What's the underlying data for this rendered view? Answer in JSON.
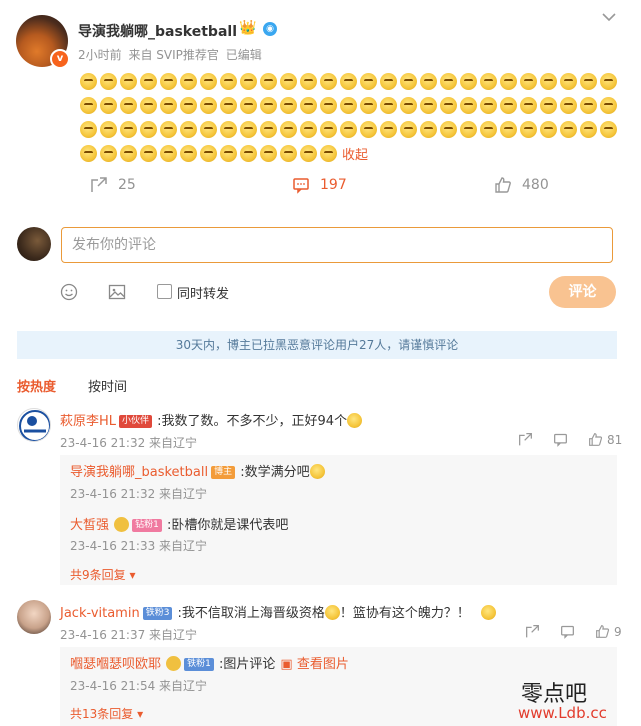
{
  "post": {
    "author": "导演我躺哪_basketball",
    "meta": {
      "time": "2小时前",
      "source": "来自 SVIP推荐官",
      "edited": "已编辑"
    },
    "emoji_count": 94,
    "collapse_label": "收起",
    "forwards": "25",
    "comments": "197",
    "likes": "480"
  },
  "composer": {
    "placeholder": "发布你的评论",
    "forward_label": "同时转发",
    "submit_label": "评论"
  },
  "notice": "30天内，博主已拉黑恶意评论用户27人，请谨慎评论",
  "sort": {
    "hot": "按热度",
    "time": "按时间"
  },
  "comments": [
    {
      "name": "萩原李HL",
      "tag": "小伙伴",
      "text": ":我数了数。不多不少，正好94个",
      "time": "23-4-16 21:32 来自辽宁",
      "likes": "81",
      "replies": [
        {
          "name": "导演我躺哪_basketball",
          "tag": "博主",
          "text": ":数学满分吧",
          "time": "23-4-16 21:32 来自辽宁"
        },
        {
          "name": "大皙强",
          "tag": "钻粉1",
          "text": ":卧槽你就是课代表吧",
          "time": "23-4-16 21:33 来自辽宁"
        }
      ],
      "more": "共9条回复"
    },
    {
      "name": "Jack-vitamin",
      "tag": "铁粉3",
      "text": ":我不信取消上海晋级资格",
      "text2": "！篮协有这个魄力？！",
      "time": "23-4-16 21:37 来自辽宁",
      "likes": "9",
      "replies": [
        {
          "name": "嗰瑟嗰瑟呗欧耶",
          "tag": "铁粉1",
          "text": ":图片评论",
          "link": "查看图片",
          "time": "23-4-16 21:54 来自辽宁"
        }
      ],
      "more": "共13条回复"
    }
  ],
  "watermark": {
    "line1": "零点吧",
    "line2": "www.Ldb.cc"
  },
  "colors": {
    "accent": "#ea5c2f",
    "notice_bg": "#e8f3fc",
    "submit_bg": "#f9c391"
  }
}
